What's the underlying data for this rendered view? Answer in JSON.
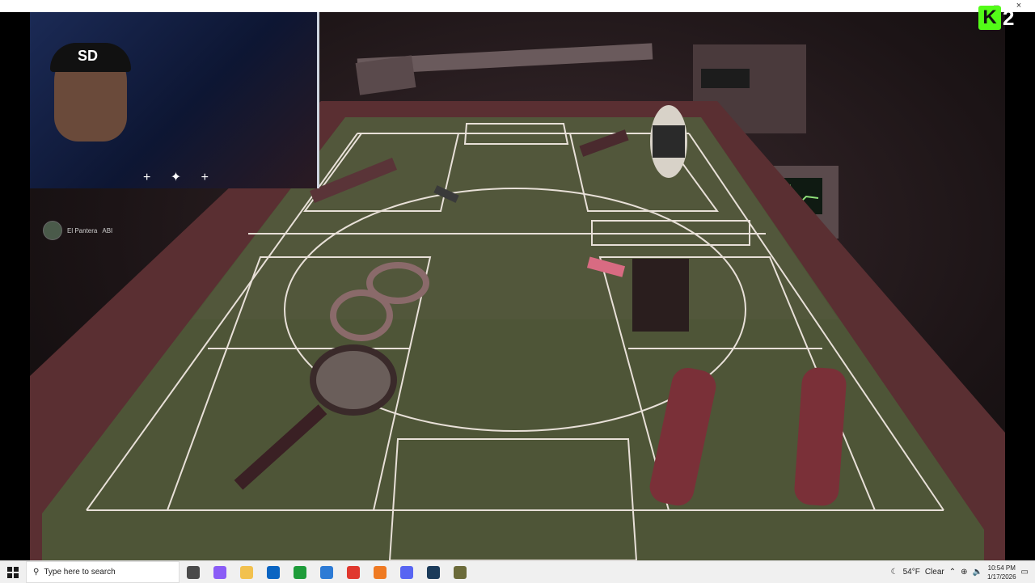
{
  "overlay": {
    "viewer_name": "El Pantera",
    "viewer_badge": "ABI",
    "cam_cap_text": "SD",
    "sparkles": "+ ✦ +",
    "logo_letter": "K",
    "logo_number": "2"
  },
  "window": {
    "minimize_icon": "–",
    "close_icon": "×"
  },
  "taskbar": {
    "search_placeholder": "Type here to search",
    "weather_temp": "54°F",
    "weather_cond": "Clear",
    "time": "10:54 PM",
    "date": "1/17/2026",
    "apps": [
      {
        "name": "task-view",
        "color": "#4a4a4a"
      },
      {
        "name": "copilot",
        "color": "#8a5cf6"
      },
      {
        "name": "file-explorer",
        "color": "#f2c14e"
      },
      {
        "name": "outlook",
        "color": "#0a64c2"
      },
      {
        "name": "app-green",
        "color": "#1e9c3a"
      },
      {
        "name": "store",
        "color": "#2d7bd5"
      },
      {
        "name": "chrome",
        "color": "#e0382e"
      },
      {
        "name": "app-orange",
        "color": "#ef7a22"
      },
      {
        "name": "discord",
        "color": "#5865f2"
      },
      {
        "name": "steam",
        "color": "#1b3b5a"
      },
      {
        "name": "game-icon",
        "color": "#6b6b3a"
      }
    ]
  },
  "colors": {
    "kick_green": "#53fc18",
    "felt": "#4e5537",
    "felt_dark": "#3b3e2c",
    "chalk": "#e8e0d8",
    "rail": "#5a2f32"
  }
}
